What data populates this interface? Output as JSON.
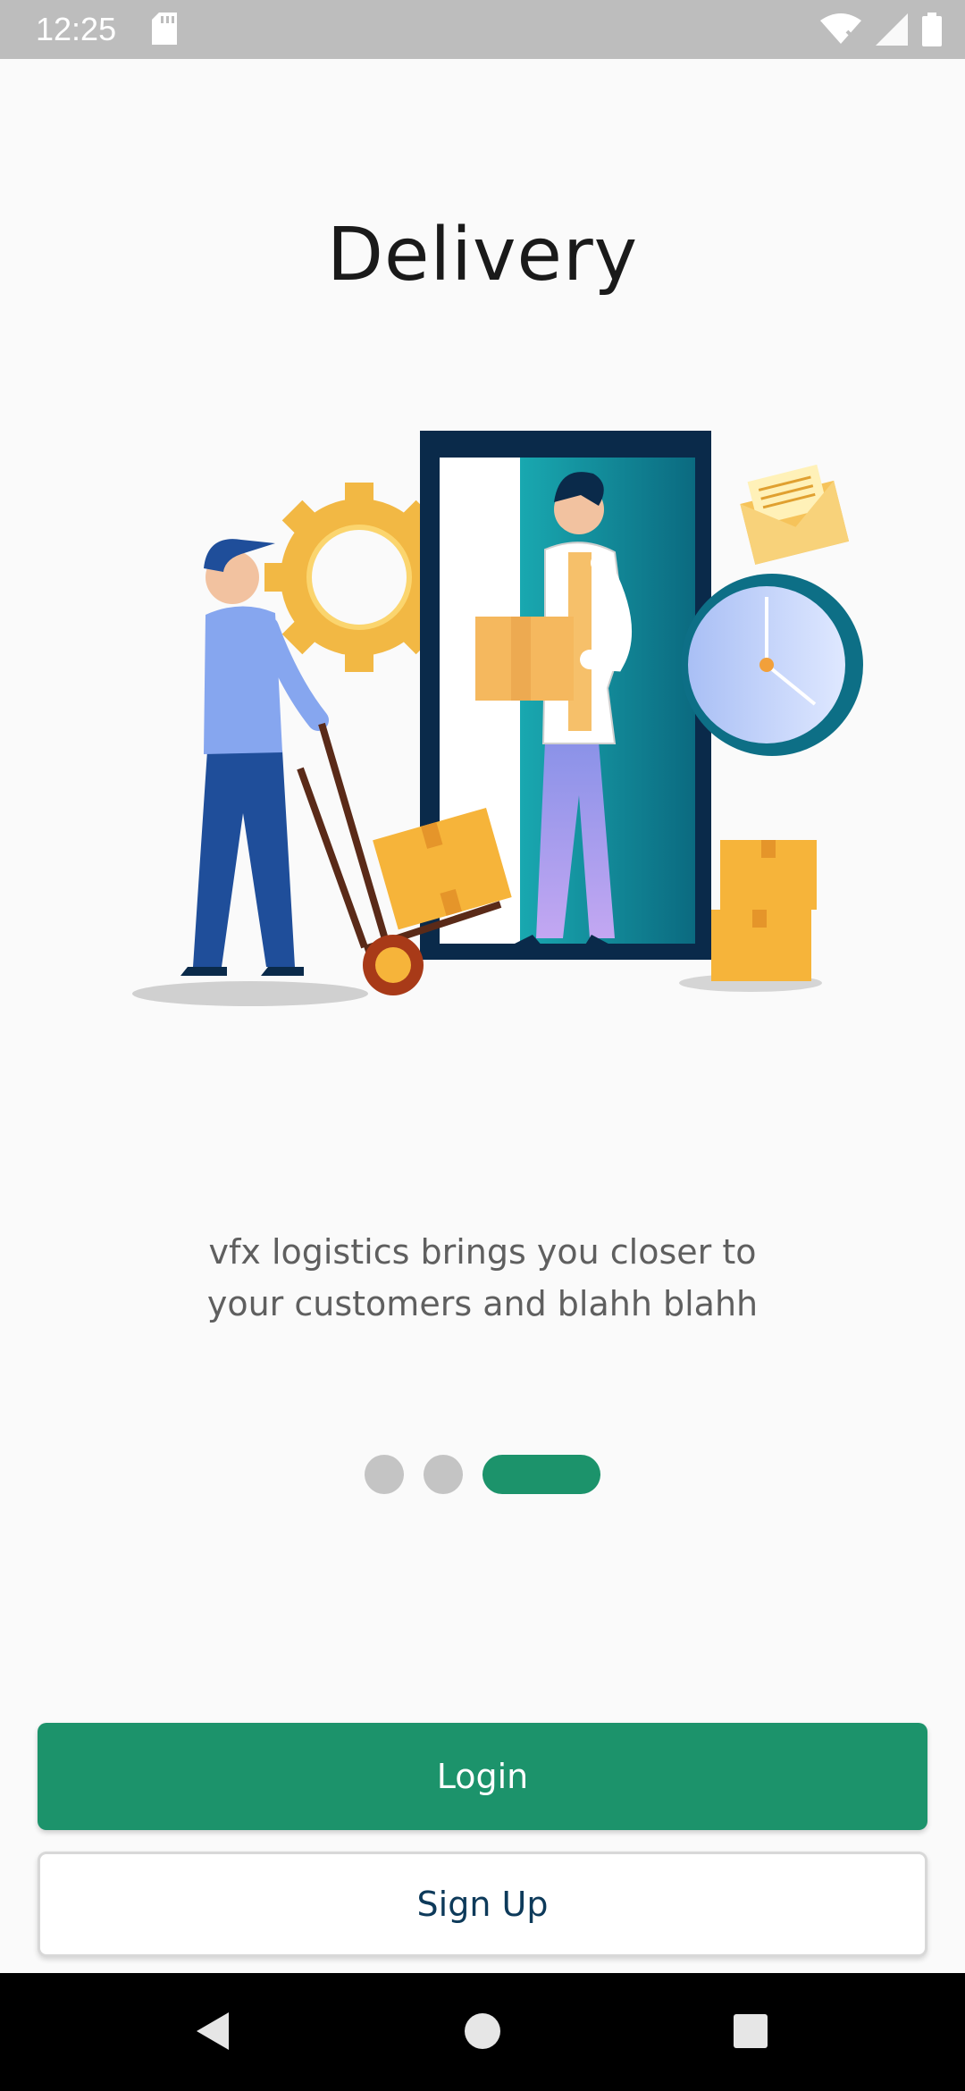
{
  "status_bar": {
    "time": "12:25",
    "icons": [
      "sd-card-icon",
      "wifi-icon",
      "signal-icon",
      "battery-icon"
    ]
  },
  "onboarding": {
    "title": "Delivery",
    "description_line1": "vfx logistics brings you closer to",
    "description_line2": "your customers and blahh blahh",
    "page_indicator": {
      "total": 3,
      "active_index": 2
    }
  },
  "actions": {
    "login_label": "Login",
    "signup_label": "Sign Up"
  },
  "nav_bar": {
    "icons": [
      "back-icon",
      "home-icon",
      "recents-icon"
    ]
  },
  "colors": {
    "accent": "#1c936b",
    "signup_text": "#0d3a5a",
    "status_bar": "#bdbdbd"
  }
}
